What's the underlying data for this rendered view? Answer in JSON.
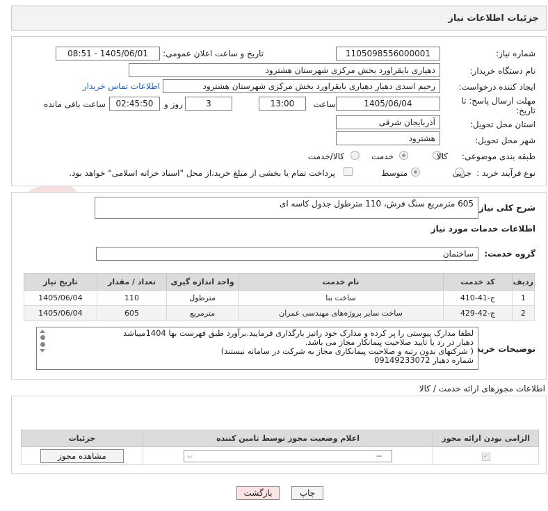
{
  "header": {
    "title": "جزئیات اطلاعات نیاز"
  },
  "form": {
    "need_number_label": "شماره نیاز:",
    "need_number": "1105098556000001",
    "announce_label": "تاریخ و ساعت اعلان عمومی:",
    "announce_value": "1405/06/01 - 08:51",
    "buyer_org_label": "نام دستگاه خریدار:",
    "buyer_org": "دهیاری بایقراورد بخش مرکزی شهرستان هشترود",
    "creator_label": "ایجاد کننده درخواست:",
    "creator": "رحیم اسدی دهیار دهیاری بایقراورد بخش مرکزی شهرستان هشترود",
    "contact_link": "اطلاعات تماس خریدار",
    "deadline_label_1": "مهلت ارسال پاسخ: تا",
    "deadline_label_2": "تاریخ:",
    "deadline_date": "1405/06/04",
    "time_label": "ساعت",
    "deadline_time": "13:00",
    "days_value": "3",
    "days_label": "روز و",
    "remaining_time": "02:45:50",
    "remaining_label": "ساعت باقی مانده",
    "province_label": "استان محل تحویل:",
    "province": "آذربایجان شرقی",
    "city_label": "شهر محل تحویل:",
    "city": "هشترود",
    "category_label": "طبقه بندی موضوعی:",
    "category_options": [
      "کالا",
      "خدمت",
      "کالا/خدمت"
    ],
    "category_selected": "خدمت",
    "process_label": "نوع فرآیند خرید :",
    "process_options": [
      "جزیی",
      "متوسط"
    ],
    "process_selected": "متوسط",
    "payment_note": "پرداخت تمام یا بخشی از مبلغ خرید،از محل \"اسناد خزانه اسلامی\" خواهد بود."
  },
  "summary": {
    "label": "شرح کلی نیاز:",
    "text": "605 مترمربع سنگ فرش، 110 مترطول جدول کاسه ای"
  },
  "services_section": {
    "title": "اطلاعات خدمات مورد نیاز",
    "group_label": "گروه خدمت:",
    "group_value": "ساختمان",
    "columns": [
      "ردیف",
      "کد خدمت",
      "نام خدمت",
      "واحد اندازه گیری",
      "تعداد / مقدار",
      "تاریخ نیاز"
    ],
    "rows": [
      [
        "1",
        "ج-41-410",
        "ساخت بنا",
        "مترطول",
        "110",
        "1405/06/04"
      ],
      [
        "2",
        "ج-42-429",
        "ساخت سایر پروژه‌های مهندسی عمران",
        "مترمربع",
        "605",
        "1405/06/04"
      ]
    ]
  },
  "buyer_notes": {
    "label": "توضیحات خریدار:",
    "lines": [
      "لطفا مدارک پیوستی را پر کرده و مدارک خود رانیز بارگذاری فرمایید.برآورد طبق فهرست بها 1404میباشد",
      "دهیار در رد یا تایید صلاحیت پیمانکار مجاز می باشد.",
      "( شرکتهای بدون رتبه و صلاحیت پیمانکاری مجاز به شرکت در سامانه نیستند)",
      "شماره دهیار 09149233072"
    ]
  },
  "licenses": {
    "title": "اطلاعات مجوزهای ارائه خدمت / کالا",
    "columns": [
      "الزامی بودن ارائه مجوز",
      "اعلام وضعیت مجوز توسط تامین کننده",
      "جزئیات"
    ],
    "row": {
      "status_value": "--",
      "details_button": "مشاهده مجوز"
    }
  },
  "footer": {
    "print_button": "چاپ",
    "back_button": "بازگشت"
  },
  "colors": {
    "back_button_bg": "#fde3e3",
    "header_bg": "#f3f3f3",
    "table_header_bg": "#dcdcdc"
  }
}
